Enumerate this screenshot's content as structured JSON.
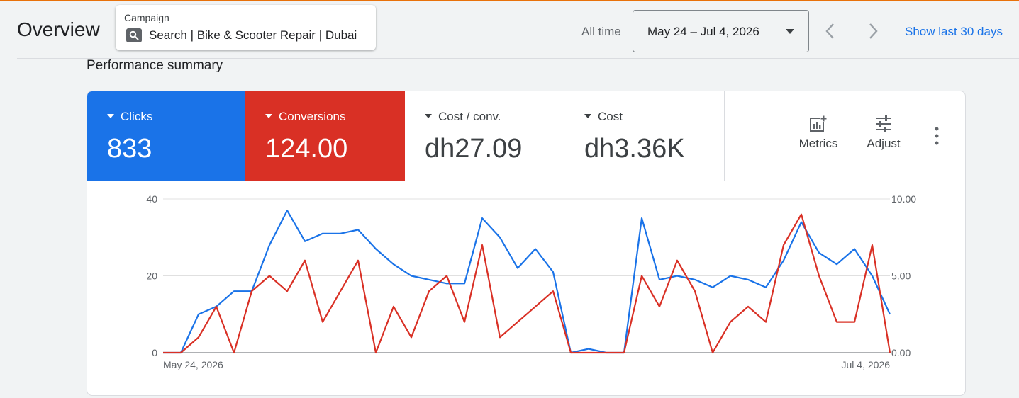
{
  "header": {
    "title": "Overview",
    "campaign_label": "Campaign",
    "campaign_name": "Search | Bike & Scooter Repair | Dubai",
    "campaign_icon": "search-icon",
    "range_label": "All time",
    "date_range": "May 24 – Jul 4, 2026",
    "show_last": "Show last 30 days"
  },
  "summary": {
    "title": "Performance summary",
    "metrics": [
      {
        "label": "Clicks",
        "value": "833",
        "color": "#1a73e8"
      },
      {
        "label": "Conversions",
        "value": "124.00",
        "color": "#d93025"
      },
      {
        "label": "Cost / conv.",
        "value": "dh27.09"
      },
      {
        "label": "Cost",
        "value": "dh3.36K"
      }
    ],
    "tools": {
      "metrics_label": "Metrics",
      "adjust_label": "Adjust"
    }
  },
  "chart_data": {
    "type": "line",
    "x_start_label": "May 24, 2026",
    "x_end_label": "Jul 4, 2026",
    "left_axis": {
      "ticks": [
        "0",
        "20",
        "40"
      ],
      "ylim": [
        0,
        40
      ]
    },
    "right_axis": {
      "ticks": [
        "0.00",
        "5.00",
        "10.00"
      ],
      "ylim": [
        0,
        10
      ]
    },
    "grid": true,
    "series": [
      {
        "axis": "left",
        "color": "#1a73e8",
        "values": [
          0,
          0,
          10,
          12,
          16,
          16,
          28,
          37,
          29,
          31,
          31,
          32,
          27,
          23,
          20,
          19,
          18,
          18,
          35,
          30,
          22,
          27,
          21,
          0,
          1,
          0,
          0,
          35,
          19,
          20,
          19,
          17,
          20,
          19,
          17,
          24,
          34,
          26,
          23,
          27,
          20,
          10
        ]
      },
      {
        "axis": "right",
        "color": "#d93025",
        "values": [
          0,
          0,
          1,
          3,
          0,
          4,
          5,
          4,
          6,
          2,
          4,
          6,
          0,
          3,
          1,
          4,
          5,
          2,
          7,
          1,
          2,
          3,
          4,
          0,
          0,
          0,
          0,
          5,
          3,
          6,
          4,
          0,
          2,
          3,
          2,
          7,
          9,
          5,
          2,
          2,
          7,
          0
        ]
      }
    ]
  }
}
